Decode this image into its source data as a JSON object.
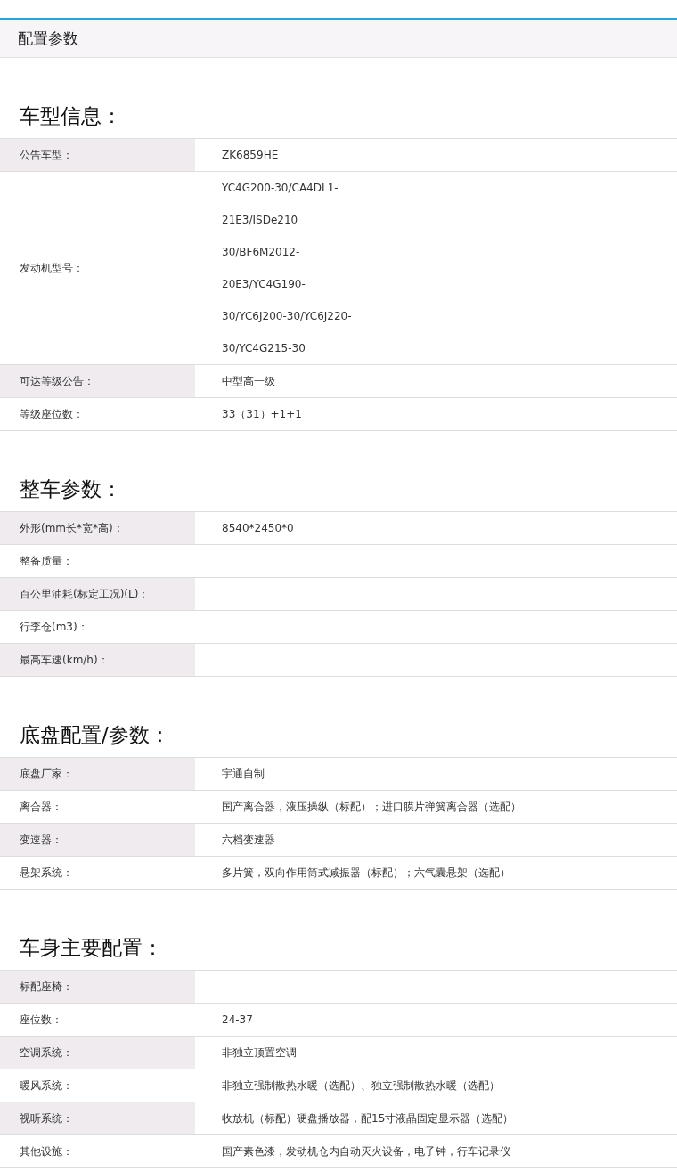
{
  "header": {
    "title": "配置参数"
  },
  "sections": [
    {
      "title": "车型信息：",
      "rows": [
        {
          "label": "公告车型：",
          "value_lines": [
            "ZK6859HE"
          ]
        },
        {
          "label": "发动机型号：",
          "value_lines": [
            "YC4G200-30/CA4DL1-",
            "21E3/ISDe210",
            "30/BF6M2012-",
            "20E3/YC4G190-",
            "30/YC6J200-30/YC6J220-",
            "30/YC4G215-30"
          ]
        },
        {
          "label": "可达等级公告：",
          "value_lines": [
            "中型高一级"
          ]
        },
        {
          "label": "等级座位数：",
          "value_lines": [
            "33（31）+1+1"
          ]
        }
      ]
    },
    {
      "title": "整车参数：",
      "rows": [
        {
          "label": "外形(mm长*宽*高)：",
          "value_lines": [
            "8540*2450*0"
          ]
        },
        {
          "label": "整备质量："
        },
        {
          "label": "百公里油耗(标定工况)(L)："
        },
        {
          "label": "行李仓(m3)："
        },
        {
          "label": "最高车速(km/h)："
        }
      ]
    },
    {
      "title": "底盘配置/参数：",
      "rows": [
        {
          "label": "底盘厂家：",
          "value_lines": [
            "宇通自制"
          ]
        },
        {
          "label": "离合器：",
          "value_lines": [
            "国产离合器，液压操纵（标配）；进口膜片弹簧离合器（选配）"
          ]
        },
        {
          "label": "变速器：",
          "value_lines": [
            "六档变速器"
          ]
        },
        {
          "label": "悬架系统：",
          "value_lines": [
            "多片簧，双向作用筒式减振器（标配）；六气囊悬架（选配）"
          ]
        }
      ]
    },
    {
      "title": "车身主要配置：",
      "rows": [
        {
          "label": "标配座椅："
        },
        {
          "label": "座位数：",
          "value_lines": [
            "24-37"
          ]
        },
        {
          "label": "空调系统：",
          "value_lines": [
            "非独立顶置空调"
          ]
        },
        {
          "label": "暖风系统：",
          "value_lines": [
            "非独立强制散热水暖（选配）、独立强制散热水暖（选配）"
          ]
        },
        {
          "label": "视听系统：",
          "value_lines": [
            "收放机（标配）硬盘播放器，配15寸液晶固定显示器（选配）"
          ]
        },
        {
          "label": "其他设施：",
          "value_lines": [
            "国产素色漆，发动机仓内自动灭火设备，电子钟，行车记录仪"
          ]
        }
      ]
    }
  ]
}
